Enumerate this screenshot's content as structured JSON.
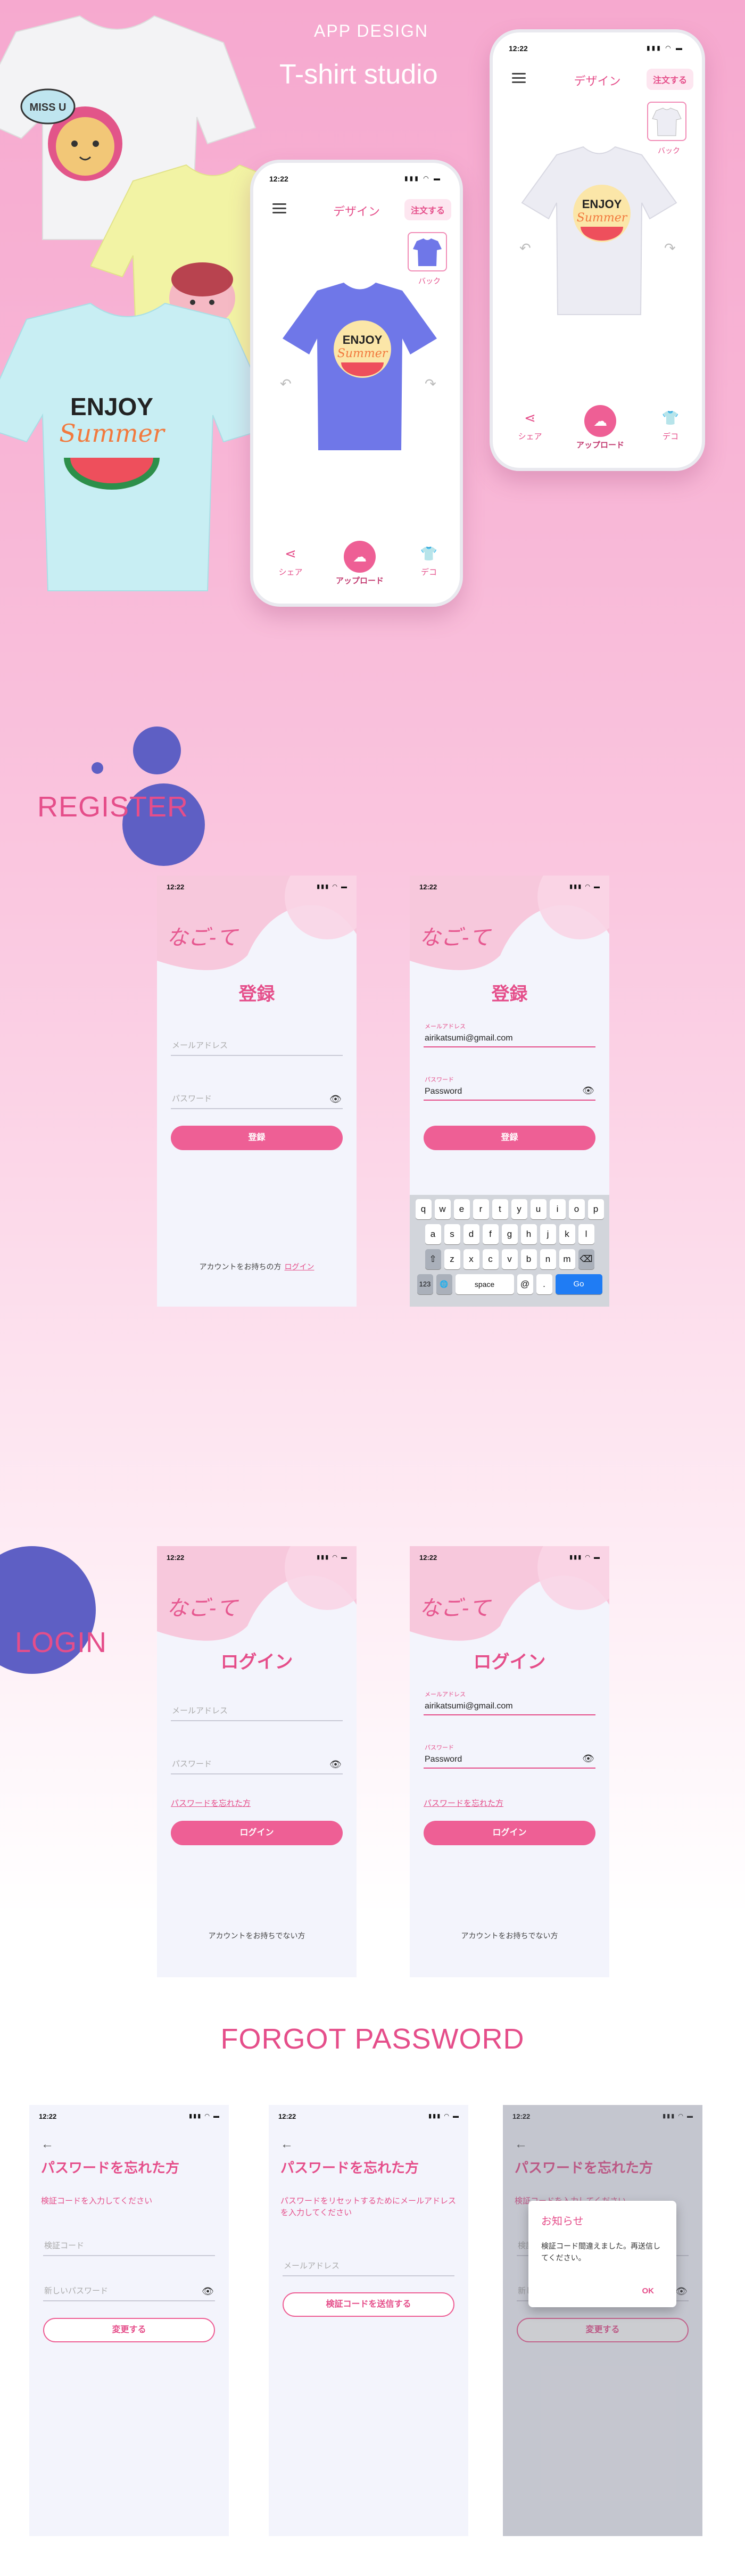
{
  "header": {
    "app_design": "APP DESIGN",
    "studio": "T-shirt studio"
  },
  "hero": {
    "time": "12:22",
    "status_icons": "▮▮▮ ◠ ▬",
    "title": "デザイン",
    "order": "注文する",
    "back_label": "バック",
    "nav": {
      "share": "シェア",
      "upload": "アップロード",
      "deco": "デコ"
    },
    "sticker": {
      "enjoy": "ENJOY",
      "summer": "Summer",
      "miss": "MISS U"
    }
  },
  "sections": {
    "register": "REGISTER",
    "login": "LOGIN",
    "forgot": "FORGOT PASSWORD"
  },
  "register": {
    "logo": "なご-て",
    "heading": "登録",
    "email_placeholder": "メールアドレス",
    "password_placeholder": "パスワード",
    "email_label": "メールアドレス",
    "password_label": "パスワード",
    "email_value": "airikatsumi@gmail.com",
    "password_value": "Password",
    "button": "登録",
    "footer": "アカウントをお持ちの方",
    "footer_link": "ログイン",
    "keyboard": {
      "row1": [
        "q",
        "w",
        "e",
        "r",
        "t",
        "y",
        "u",
        "i",
        "o",
        "p"
      ],
      "row2": [
        "a",
        "s",
        "d",
        "f",
        "g",
        "h",
        "j",
        "k",
        "l"
      ],
      "row3": [
        "z",
        "x",
        "c",
        "v",
        "b",
        "n",
        "m"
      ],
      "shift": "⇧",
      "delete": "⌫",
      "numbers": "123",
      "globe": "🌐",
      "space": "space",
      "at": "@",
      "dot": ".",
      "go": "Go"
    }
  },
  "login": {
    "heading": "ログイン",
    "email_placeholder": "メールアドレス",
    "password_placeholder": "パスワード",
    "email_label": "メールアドレス",
    "password_label": "パスワード",
    "email_value": "airikatsumi@gmail.com",
    "password_value": "Password",
    "forgot": "パスワードを忘れた方",
    "button": "ログイン",
    "footer": "アカウントをお持ちでない方"
  },
  "forgot": {
    "heading": "パスワードを忘れた方",
    "desc1": "検証コードを入力してください",
    "code_placeholder": "検証コード",
    "new_password_placeholder": "新しいパスワード",
    "change_button": "変更する",
    "desc2": "パスワードをリセットするためにメールアドレスを入力してください",
    "email_placeholder": "メールアドレス",
    "send_button": "検証コードを送信する",
    "dialog_title": "お知らせ",
    "dialog_msg": "検証コード間違えました。再送信してください。",
    "dialog_ok": "OK"
  },
  "colors": {
    "accent": "#e54e8a",
    "button": "#ee5f95",
    "blob": "#5e5fc4",
    "shirt_blue": "#6f77e8"
  }
}
